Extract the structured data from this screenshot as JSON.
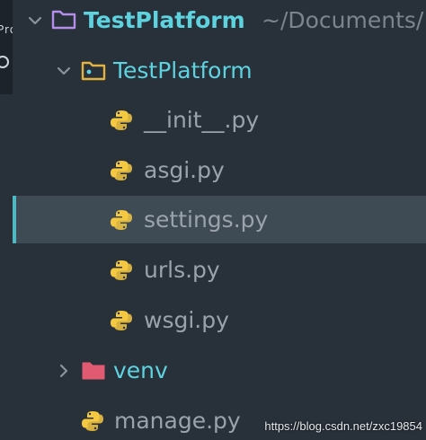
{
  "tree": {
    "root": {
      "label": "TestPlatform",
      "path": "~/Documents/"
    },
    "package": {
      "label": "TestPlatform"
    },
    "files": [
      {
        "label": "__init__.py"
      },
      {
        "label": "asgi.py"
      },
      {
        "label": "settings.py"
      },
      {
        "label": "urls.py"
      },
      {
        "label": "wsgi.py"
      }
    ],
    "venv": {
      "label": "venv"
    },
    "manage": {
      "label": "manage.py"
    }
  },
  "selected_file": "settings.py",
  "colors": {
    "background": "#28303a",
    "accent": "#5ed3e0",
    "selection": "#3e4b54",
    "root_folder_icon": "#b48ee8",
    "package_folder_icon": "#e3b341",
    "venv_folder_icon": "#e05a72",
    "python_blue": "#4a86c8",
    "python_yellow": "#f5c842"
  },
  "sidebar_strip": {
    "text": "Proj"
  },
  "watermark": "https://blog.csdn.net/zxc19854"
}
